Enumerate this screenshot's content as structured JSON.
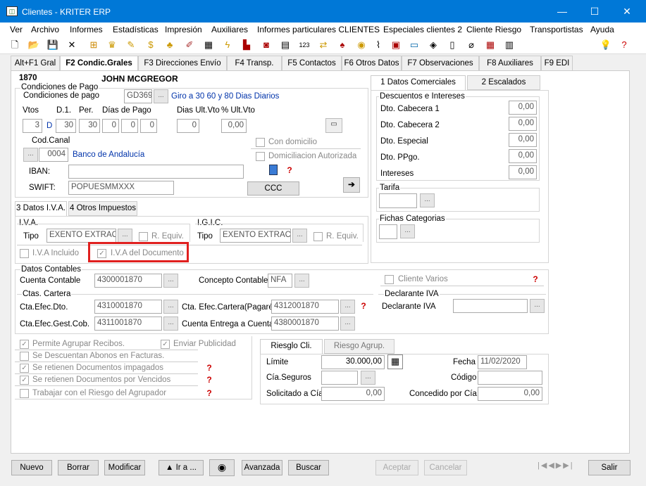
{
  "window": {
    "title": "Clientes - KRITER ERP",
    "icon": "app-icon",
    "minimize": "—",
    "maximize": "☐",
    "close": "✕"
  },
  "menu": [
    "Ver",
    "Archivo",
    "Informes",
    "Estadísticas",
    "Impresión",
    "Auxiliares",
    "Informes particulares CLIENTES",
    "Especiales clientes 2",
    "Cliente Riesgo",
    "Transportistas",
    "Ayuda"
  ],
  "toolbar": {
    "icons": [
      "new-icon",
      "open-icon",
      "save-icon",
      "delete-icon",
      "tree-icon",
      "trophy-icon",
      "pen-icon",
      "dollar-icon",
      "bell-icon",
      "brush-icon",
      "grid-icon",
      "lightning-icon",
      "bar-chart-icon",
      "camera-icon",
      "table-icon",
      "counter-icon",
      "arrows-icon",
      "hat-icon",
      "disc-icon",
      "paperclip-icon",
      "document-icon",
      "window-icon",
      "tag-icon",
      "note-icon",
      "attach-icon",
      "calendar-icon",
      "barcode-icon"
    ],
    "right_icons": [
      "bulb-icon",
      "help-icon"
    ]
  },
  "tabs": [
    "Alt+F1 Gral",
    "F2 Condic.Grales",
    "F3 Direcciones Envío",
    "F4 Transp.",
    "F5 Contactos",
    "F6 Otros Datos",
    "F7 Observaciones",
    "F8 Auxiliares",
    "F9 EDI"
  ],
  "client": {
    "code": "1870",
    "name": "JOHN MCGREGOR"
  },
  "pago": {
    "group_title": "Condiciones de Pago",
    "label": "Condiciones de pago",
    "code": "GD369",
    "desc": "Giro a 30 60 y 80 Dias Diarios",
    "vtos_label": "Vtos",
    "d1_label": "D.1.",
    "per_label": "Per.",
    "dias_label": "Días de Pago",
    "dias_ult_label": "Dias Ult.Vto",
    "pct_label": "% Ult.Vto",
    "vtos": "3",
    "d": "D",
    "d1": "30",
    "per": "30",
    "dia1": "0",
    "dia2": "0",
    "dia3": "0",
    "dias_ult": "0",
    "pct": "0,00",
    "canal_label": "Cod.Canal",
    "canal_code": "0004",
    "canal_desc": "Banco de Andalucía",
    "con_domicilio": "Con domicilio",
    "domiciliacion": "Domiciliacion Autorizada",
    "iban_label": "IBAN:",
    "iban": "",
    "swift_label": "SWIFT:",
    "swift": "POPUESMMXXX",
    "ccc": "CCC"
  },
  "impuestos": {
    "tabs": [
      "3 Datos I.V.A.",
      "4 Otros Impuestos"
    ],
    "iva_title": "I.V.A.",
    "igic_title": "I.G.I.C.",
    "tipo_label": "Tipo",
    "iva_tipo": "EXENTO EXTRACO",
    "igic_tipo": "EXENTO EXTRACO",
    "requiv": "R. Equiv.",
    "iva_incluido": "I.V.A Incluido",
    "iva_documento": "I.V.A del Documento"
  },
  "comerciales": {
    "tabs": [
      "1 Datos Comerciales",
      "2 Escalados"
    ],
    "group_title": "Descuentos e Intereses",
    "rows": [
      {
        "label": "Dto. Cabecera 1",
        "value": "0,00"
      },
      {
        "label": "Dto. Cabecera 2",
        "value": "0,00"
      },
      {
        "label": "Dto. Especial",
        "value": "0,00"
      },
      {
        "label": "Dto. PPgo.",
        "value": "0,00"
      },
      {
        "label": "Intereses",
        "value": "0,00"
      }
    ],
    "tarifa": "Tarifa",
    "fichas": "Fichas Categorias"
  },
  "contables": {
    "group_title": "Datos Contables",
    "cuenta_label": "Cuenta Contable",
    "cuenta": "4300001870",
    "concepto_label": "Concepto Contable",
    "concepto": "NFA",
    "cartera_title": "Ctas. Cartera",
    "efec_dto_label": "Cta.Efec.Dto.",
    "efec_dto": "4310001870",
    "efec_cartera_label": "Cta. Efec.Cartera(Pagaré)",
    "efec_cartera": "4312001870",
    "efec_gest_label": "Cta.Efec.Gest.Cob.",
    "efec_gest": "4311001870",
    "entrega_label": "Cuenta Entrega a Cuenta",
    "entrega": "4380001870",
    "cliente_varios": "Cliente Varios",
    "declarante_title": "Declarante IVA",
    "declarante_label": "Declarante IVA",
    "declarante": ""
  },
  "checks": {
    "agrupar": "Permite Agrupar Recibos.",
    "publicidad": "Enviar Publicidad",
    "abonos": "Se Descuentan Abonos en Facturas.",
    "impagados": "Se retienen Documentos impagados",
    "vencidos": "Se retienen Documentos por Vencidos",
    "riesgo_agrupador": "Trabajar con el Riesgo del Agrupador"
  },
  "riesgo": {
    "tabs": [
      "Riesglo Cli.",
      "Riesgo Agrup."
    ],
    "limite_label": "Límite",
    "limite": "30.000,00",
    "fecha_label": "Fecha",
    "fecha": "11/02/2020",
    "seguros_label": "Cía.Seguros",
    "seguros": "",
    "codigo_label": "Código",
    "codigo": "",
    "solicitado_label": "Solicitado a Cía",
    "solicitado": "0,00",
    "concedido_label": "Concedido por Cía.",
    "concedido": "0,00"
  },
  "buttons": {
    "nuevo": "Nuevo",
    "borrar": "Borrar",
    "modificar": "Modificar",
    "ira": "▲ Ir a ...",
    "avanzada": "Avanzada",
    "buscar": "Buscar",
    "aceptar": "Aceptar",
    "cancelar": "Cancelar",
    "salir": "Salir"
  },
  "colors": {
    "titlebar": "#0078d7",
    "link_blue": "#0033aa",
    "highlight": "#e0201f"
  }
}
